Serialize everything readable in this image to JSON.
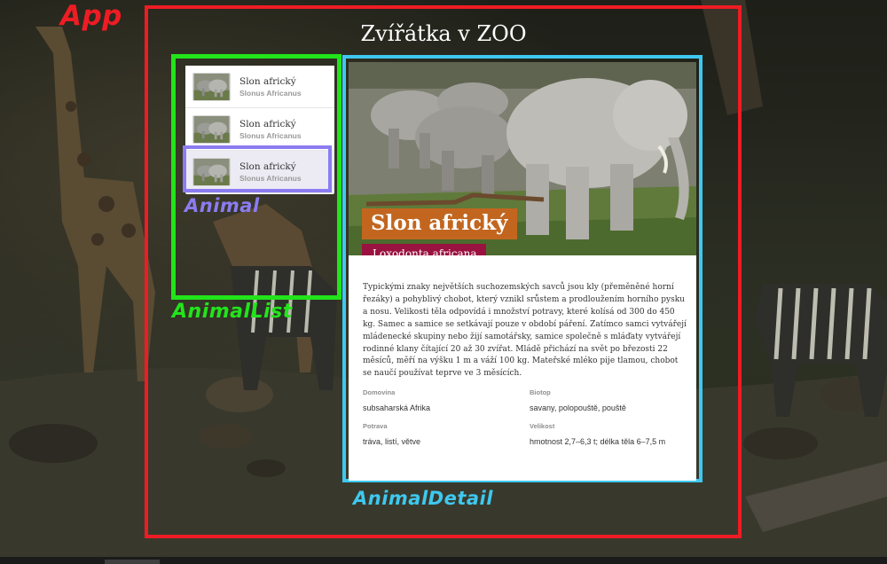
{
  "app": {
    "title": "Zvířátka v ZOO",
    "annotation_label": "App"
  },
  "animal_list": {
    "annotation_label": "AnimalList",
    "items": [
      {
        "name": "Slon africký",
        "latin": "Slonus Africanus"
      },
      {
        "name": "Slon africký",
        "latin": "Slonus Africanus"
      },
      {
        "name": "Slon africký",
        "latin": "Slonus Africanus",
        "selected": true
      }
    ],
    "item_annotation_label": "Animal"
  },
  "animal_detail": {
    "annotation_label": "AnimalDetail",
    "name": "Slon africký",
    "latin": "Loxodonta africana",
    "description": "Typickými znaky největších suchozemských savců jsou kly (přeměněné horní řezáky) a pohyblivý chobot, který vznikl srůstem a prodloužením horního pysku a nosu. Velikosti těla odpovídá i množství potravy, které kolísá od 300 do 450 kg. Samec a samice se setkávají pouze v období páření. Zatímco samci vytvářejí mládenecké skupiny nebo žijí samotářsky, samice společně s mláďaty vytvářejí rodinné klany čítající 20 až 30 zvířat. Mládě přichází na svět po březosti 22 měsíců, měří na výšku 1 m a váží 100 kg. Mateřské mléko pije tlamou, chobot se naučí používat teprve ve 3 měsících.",
    "info": {
      "domovina": {
        "label": "Domovina",
        "value": "subsaharská Afrika"
      },
      "biotop": {
        "label": "Biotop",
        "value": "savany, polopouště, pouště"
      },
      "potrava": {
        "label": "Potrava",
        "value": "tráva, listí, větve"
      },
      "velikost": {
        "label": "Velikost",
        "value": "hmotnost 2,7–6,3 t; délka těla 6–7,5 m"
      }
    }
  },
  "colors": {
    "app_box": "#ee1c24",
    "animal_list_box": "#22e41a",
    "animal_box": "#8b7cf2",
    "animal_detail_box": "#3ec8f0",
    "name_badge": "#c2661f",
    "latin_badge": "#9a1240"
  }
}
